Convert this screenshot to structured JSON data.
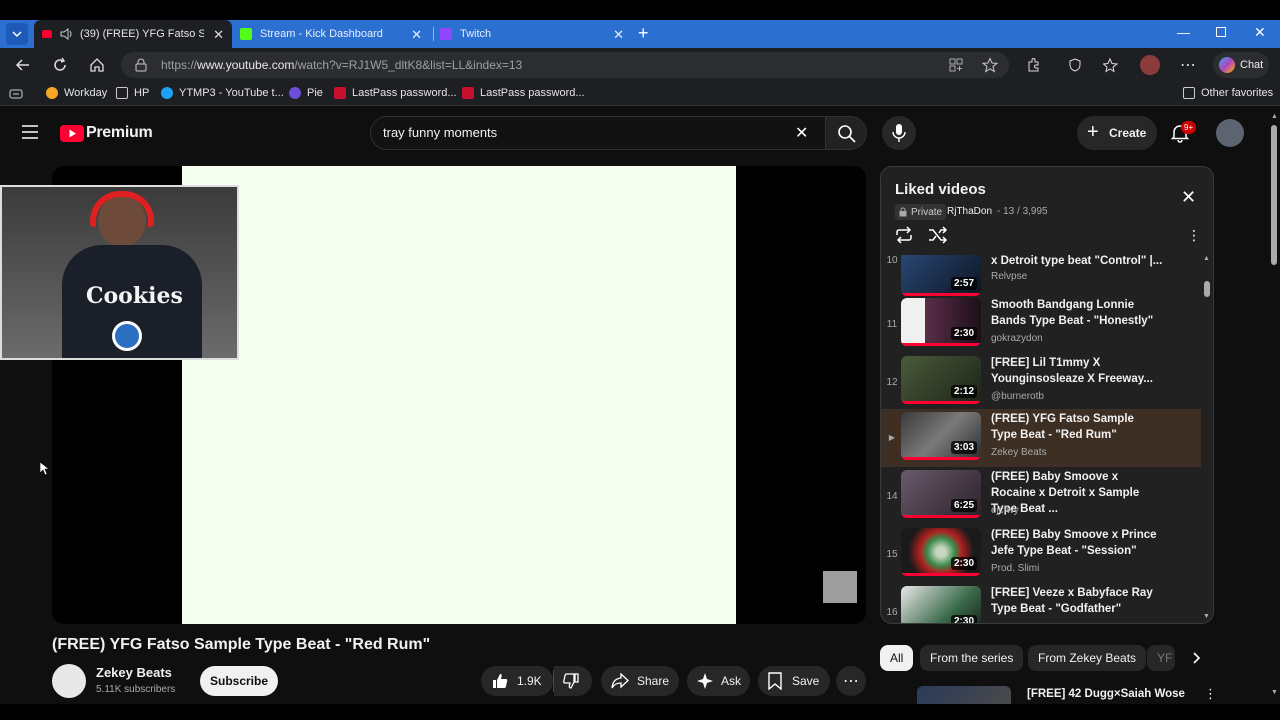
{
  "browser": {
    "tabs": [
      {
        "label": "(39) (FREE) YFG Fatso Sample Type Beat - \"Red Rum\"",
        "active": true
      },
      {
        "label": "Stream - Kick Dashboard",
        "active": false
      },
      {
        "label": "Twitch",
        "active": false
      }
    ],
    "url_prefix": "https://",
    "url_host": "www.youtube.com",
    "url_path": "/watch?v=RJ1W5_dltK8&list=LL&index=13",
    "chat_label": "Chat",
    "favorites": [
      "Workday",
      "HP",
      "YTMP3 - YouTube t...",
      "Pie",
      "LastPass password...",
      "LastPass password..."
    ],
    "other_favorites": "Other favorites"
  },
  "youtube": {
    "logo_text": "Premium",
    "search_value": "tray funny moments",
    "create_label": "Create",
    "notif_badge": "9+"
  },
  "video": {
    "title": "(FREE) YFG Fatso Sample Type Beat - \"Red Rum\"",
    "channel": "Zekey Beats",
    "subscribers": "5.11K subscribers",
    "subscribe_label": "Subscribe",
    "likes": "1.9K",
    "share_label": "Share",
    "ask_label": "Ask",
    "save_label": "Save",
    "webcam_text": "Cookies"
  },
  "playlist": {
    "title": "Liked videos",
    "privacy": "Private",
    "owner": "RjThaDon",
    "position": "- 13 / 3,995",
    "items": [
      {
        "index": "10",
        "title": "x Detroit type beat \"Control\" |...",
        "channel": "Relvpse",
        "duration": "2:57"
      },
      {
        "index": "11",
        "title": "Smooth Bandgang Lonnie Bands Type Beat - \"Honestly\"",
        "channel": "gokrazydon",
        "duration": "2:30"
      },
      {
        "index": "12",
        "title": "[FREE] Lil T1mmy X Younginsosleaze X Freeway...",
        "channel": "@burnerotb",
        "duration": "2:12"
      },
      {
        "index": "",
        "title": "(FREE) YFG Fatso Sample Type Beat - \"Red Rum\"",
        "channel": "Zekey Beats",
        "duration": "3:03"
      },
      {
        "index": "14",
        "title": "(FREE) Baby Smoove x Rocaine x Detroit x Sample Type Beat ...",
        "channel": "ejcfwy",
        "duration": "6:25"
      },
      {
        "index": "15",
        "title": "(FREE) Baby Smoove x Prince Jefe Type Beat - \"Session\"",
        "channel": "Prod. Slimi",
        "duration": "2:30"
      },
      {
        "index": "16",
        "title": "[FREE] Veeze x Babyface Ray Type Beat - \"Godfather\"",
        "channel": "",
        "duration": "2:30"
      }
    ]
  },
  "chips": [
    "All",
    "From the series",
    "From Zekey Beats",
    "YF"
  ],
  "next_video_title": "[FREE] 42 Dugg×Saiah Wose",
  "colors": {
    "accent": "#ff0033",
    "tabbar": "#2b6fd1",
    "active_row": "#3e2f24",
    "video_bg": "#f5fef0"
  }
}
